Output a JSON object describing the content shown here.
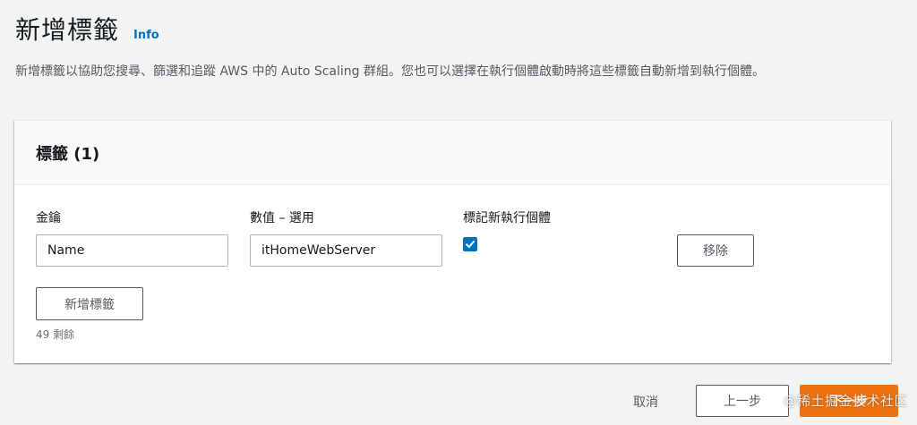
{
  "header": {
    "title": "新增標籤",
    "info_link": "Info",
    "description": "新增標籤以協助您搜尋、篩選和追蹤 AWS 中的 Auto Scaling 群組。您也可以選擇在執行個體啟動時將這些標籤自動新增到執行個體。"
  },
  "panel": {
    "title": "標籤 (1)",
    "columns": {
      "key_label": "金鑰",
      "value_label": "數值 – 選用",
      "tag_instances_label": "標記新執行個體"
    },
    "tags": [
      {
        "key": "Name",
        "value": "itHomeWebServer",
        "tag_new_instances": true
      }
    ],
    "remove_label": "移除",
    "add_tag_label": "新增標籤",
    "remaining_text": "49 剩餘"
  },
  "footer": {
    "cancel_label": "取消",
    "previous_label": "上一步",
    "next_label": "下一步"
  },
  "watermark": "@稀土掘金技术社区",
  "colors": {
    "accent": "#0073bb",
    "primary_button": "#ec7211",
    "background": "#f2f3f3"
  }
}
